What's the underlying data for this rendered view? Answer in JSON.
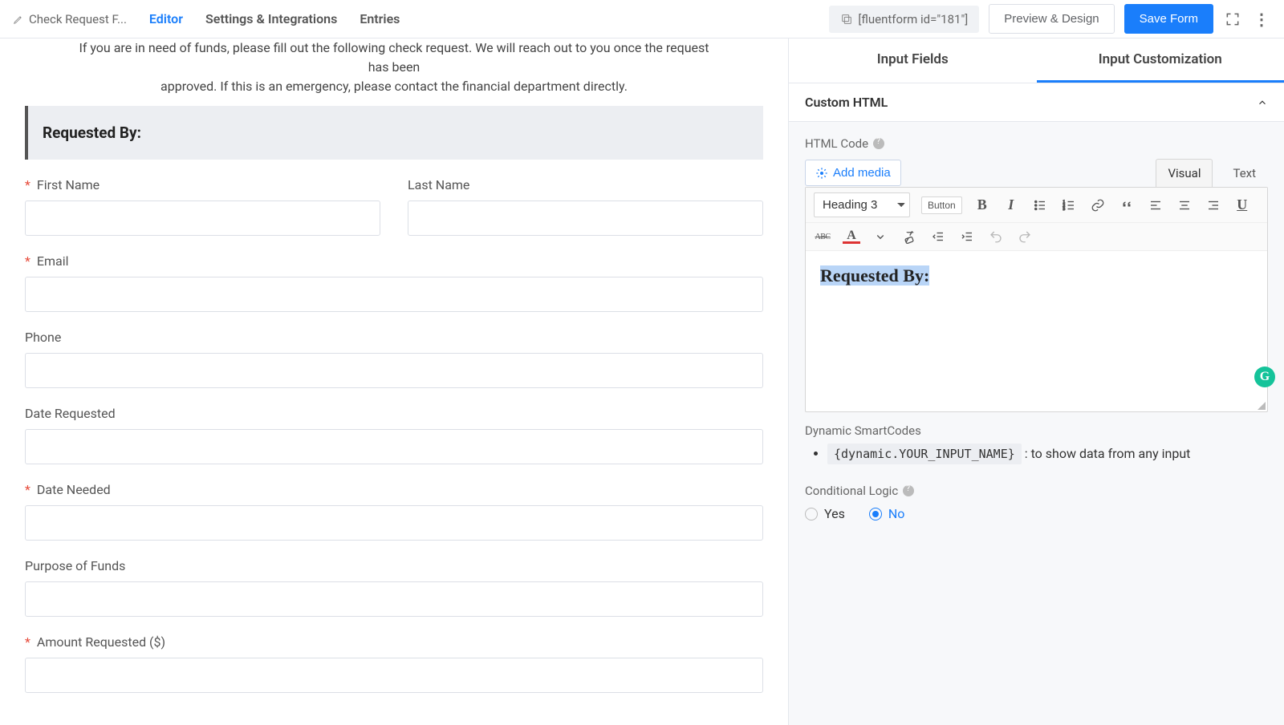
{
  "topbar": {
    "form_title": "Check Request F...",
    "nav": {
      "editor": "Editor",
      "settings": "Settings & Integrations",
      "entries": "Entries"
    },
    "shortcode": "[fluentform id=\"181\"]",
    "preview": "Preview & Design",
    "save": "Save Form"
  },
  "canvas": {
    "intro_line1": "If you are in need of funds, please fill out the following check request. We will reach out to you once the request has been",
    "intro_line2": "approved. If this is an emergency, please contact the financial department directly.",
    "section_title": "Requested By:",
    "fields": {
      "first_name": "First Name",
      "last_name": "Last Name",
      "email": "Email",
      "phone": "Phone",
      "date_requested": "Date Requested",
      "date_needed": "Date Needed",
      "purpose": "Purpose of Funds",
      "amount": "Amount Requested ($)"
    }
  },
  "sidebar": {
    "tabs": {
      "input_fields": "Input Fields",
      "input_custom": "Input Customization"
    },
    "accordion_title": "Custom HTML",
    "html_code_label": "HTML Code",
    "add_media": "Add media",
    "editor_tabs": {
      "visual": "Visual",
      "text": "Text"
    },
    "format_select": "Heading 3",
    "button_label": "Button",
    "editor_content": "Requested By:",
    "smartcodes_label": "Dynamic SmartCodes",
    "smartcode_chip": "{dynamic.YOUR_INPUT_NAME}",
    "smartcode_desc": " : to show data from any input",
    "cond_logic_label": "Conditional Logic",
    "radio": {
      "yes": "Yes",
      "no": "No"
    },
    "grammarly": "G"
  }
}
